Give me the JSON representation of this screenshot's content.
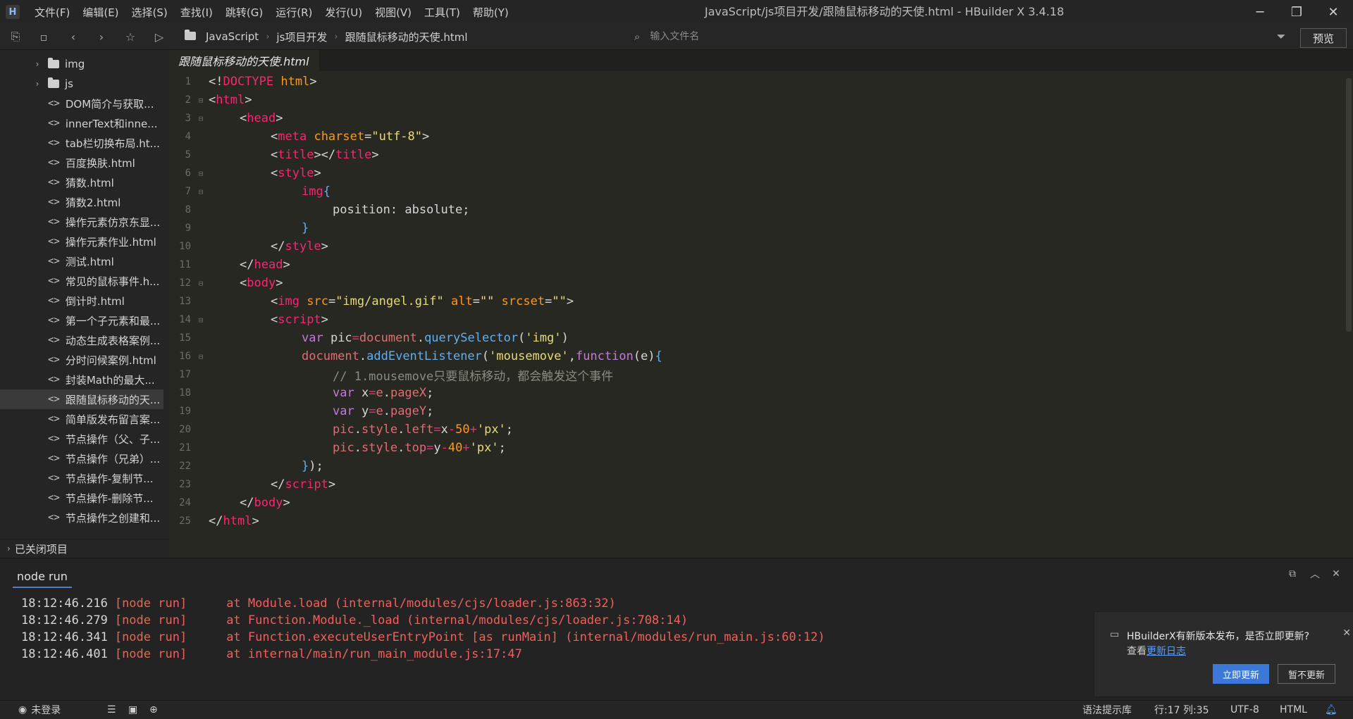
{
  "window": {
    "title": "JavaScript/js项目开发/跟随鼠标移动的天使.html - HBuilder X 3.4.18",
    "logo": "H",
    "controls": [
      "minimize-icon",
      "restore-icon",
      "close-icon"
    ]
  },
  "menu": [
    "文件(F)",
    "编辑(E)",
    "选择(S)",
    "查找(I)",
    "跳转(G)",
    "运行(R)",
    "发行(U)",
    "视图(V)",
    "工具(T)",
    "帮助(Y)"
  ],
  "toolbar": {
    "breadcrumb": [
      "JavaScript",
      "js项目开发",
      "跟随鼠标移动的天使.html"
    ],
    "file_search_placeholder": "输入文件名",
    "preview_label": "预览"
  },
  "sidebar": {
    "items": [
      {
        "label": "img",
        "type": "folder"
      },
      {
        "label": "js",
        "type": "folder"
      },
      {
        "label": "DOM简介与获取...",
        "type": "file"
      },
      {
        "label": "innerText和inne...",
        "type": "file"
      },
      {
        "label": "tab栏切换布局.ht...",
        "type": "file"
      },
      {
        "label": "百度换肤.html",
        "type": "file"
      },
      {
        "label": "猜数.html",
        "type": "file"
      },
      {
        "label": "猜数2.html",
        "type": "file"
      },
      {
        "label": "操作元素仿京东显...",
        "type": "file"
      },
      {
        "label": "操作元素作业.html",
        "type": "file"
      },
      {
        "label": "测试.html",
        "type": "file"
      },
      {
        "label": "常见的鼠标事件.h...",
        "type": "file"
      },
      {
        "label": "倒计时.html",
        "type": "file"
      },
      {
        "label": "第一个子元素和最...",
        "type": "file"
      },
      {
        "label": "动态生成表格案例...",
        "type": "file"
      },
      {
        "label": "分时问候案例.html",
        "type": "file"
      },
      {
        "label": "封装Math的最大...",
        "type": "file"
      },
      {
        "label": "跟随鼠标移动的天...",
        "type": "file",
        "selected": true
      },
      {
        "label": "简单版发布留言案...",
        "type": "file"
      },
      {
        "label": "节点操作（父、子...",
        "type": "file"
      },
      {
        "label": "节点操作（兄弟）...",
        "type": "file"
      },
      {
        "label": "节点操作-复制节...",
        "type": "file"
      },
      {
        "label": "节点操作-删除节...",
        "type": "file"
      },
      {
        "label": "节点操作之创建和...",
        "type": "file"
      }
    ],
    "closed_projects": "已关闭项目"
  },
  "editor": {
    "tab": "跟随鼠标移动的天使.html",
    "lines": [
      {
        "n": "1",
        "fold": "",
        "indent": 0,
        "tokens": [
          [
            "c-br",
            "<!"
          ],
          [
            "c-tag",
            "DOCTYPE"
          ],
          [
            "c-pl",
            " "
          ],
          [
            "c-attr",
            "html"
          ],
          [
            "c-br",
            ">"
          ]
        ]
      },
      {
        "n": "2",
        "fold": "⊟",
        "indent": 0,
        "tokens": [
          [
            "c-br",
            "<"
          ],
          [
            "c-tag",
            "html"
          ],
          [
            "c-br",
            ">"
          ]
        ]
      },
      {
        "n": "3",
        "fold": "⊟",
        "indent": 1,
        "tokens": [
          [
            "c-br",
            "<"
          ],
          [
            "c-tag",
            "head"
          ],
          [
            "c-br",
            ">"
          ]
        ]
      },
      {
        "n": "4",
        "fold": "",
        "indent": 2,
        "tokens": [
          [
            "c-br",
            "<"
          ],
          [
            "c-tag",
            "meta"
          ],
          [
            "c-pl",
            " "
          ],
          [
            "c-attr",
            "charset"
          ],
          [
            "c-br",
            "="
          ],
          [
            "c-str",
            "\"utf-8\""
          ],
          [
            "c-br",
            ">"
          ]
        ]
      },
      {
        "n": "5",
        "fold": "",
        "indent": 2,
        "tokens": [
          [
            "c-br",
            "<"
          ],
          [
            "c-tag",
            "title"
          ],
          [
            "c-br",
            "></"
          ],
          [
            "c-tag",
            "title"
          ],
          [
            "c-br",
            ">"
          ]
        ]
      },
      {
        "n": "6",
        "fold": "⊟",
        "indent": 2,
        "tokens": [
          [
            "c-br",
            "<"
          ],
          [
            "c-tag",
            "style"
          ],
          [
            "c-br",
            ">"
          ]
        ]
      },
      {
        "n": "7",
        "fold": "⊟",
        "indent": 3,
        "tokens": [
          [
            "c-tag",
            "img"
          ],
          [
            "c-fn",
            "{"
          ]
        ]
      },
      {
        "n": "8",
        "fold": "",
        "indent": 4,
        "tokens": [
          [
            "c-pl",
            "position"
          ],
          [
            "c-br",
            ": "
          ],
          [
            "c-pl",
            "absolute"
          ],
          [
            "c-br",
            ";"
          ]
        ]
      },
      {
        "n": "9",
        "fold": "",
        "indent": 3,
        "tokens": [
          [
            "c-fn",
            "}"
          ]
        ]
      },
      {
        "n": "10",
        "fold": "",
        "indent": 2,
        "tokens": [
          [
            "c-br",
            "</"
          ],
          [
            "c-tag",
            "style"
          ],
          [
            "c-br",
            ">"
          ]
        ]
      },
      {
        "n": "11",
        "fold": "",
        "indent": 1,
        "tokens": [
          [
            "c-br",
            "</"
          ],
          [
            "c-tag",
            "head"
          ],
          [
            "c-br",
            ">"
          ]
        ]
      },
      {
        "n": "12",
        "fold": "⊟",
        "indent": 1,
        "tokens": [
          [
            "c-br",
            "<"
          ],
          [
            "c-tag",
            "body"
          ],
          [
            "c-br",
            ">"
          ]
        ]
      },
      {
        "n": "13",
        "fold": "",
        "indent": 2,
        "tokens": [
          [
            "c-br",
            "<"
          ],
          [
            "c-tag",
            "img"
          ],
          [
            "c-pl",
            " "
          ],
          [
            "c-attr",
            "src"
          ],
          [
            "c-br",
            "="
          ],
          [
            "c-str",
            "\"img/angel.gif\""
          ],
          [
            "c-pl",
            " "
          ],
          [
            "c-attr",
            "alt"
          ],
          [
            "c-br",
            "="
          ],
          [
            "c-str",
            "\"\""
          ],
          [
            "c-pl",
            " "
          ],
          [
            "c-attr",
            "srcset"
          ],
          [
            "c-br",
            "="
          ],
          [
            "c-str",
            "\"\""
          ],
          [
            "c-br",
            ">"
          ]
        ]
      },
      {
        "n": "14",
        "fold": "⊟",
        "indent": 2,
        "tokens": [
          [
            "c-br",
            "<"
          ],
          [
            "c-tag",
            "script"
          ],
          [
            "c-br",
            ">"
          ]
        ]
      },
      {
        "n": "15",
        "fold": "",
        "indent": 3,
        "tokens": [
          [
            "c-kw",
            "var"
          ],
          [
            "c-pl",
            " pic"
          ],
          [
            "c-tag",
            "="
          ],
          [
            "c-var",
            "document"
          ],
          [
            "c-br",
            "."
          ],
          [
            "c-fn",
            "querySelector"
          ],
          [
            "c-br",
            "("
          ],
          [
            "c-str",
            "'img'"
          ],
          [
            "c-br",
            ")"
          ]
        ]
      },
      {
        "n": "16",
        "fold": "⊟",
        "indent": 3,
        "tokens": [
          [
            "c-var",
            "document"
          ],
          [
            "c-br",
            "."
          ],
          [
            "c-fn",
            "addEventListener"
          ],
          [
            "c-br",
            "("
          ],
          [
            "c-str",
            "'mousemove'"
          ],
          [
            "c-br",
            ","
          ],
          [
            "c-kw",
            "function"
          ],
          [
            "c-br",
            "("
          ],
          [
            "c-pl",
            "e"
          ],
          [
            "c-br",
            ")"
          ],
          [
            "c-fn",
            "{"
          ]
        ]
      },
      {
        "n": "17",
        "fold": "",
        "indent": 4,
        "tokens": [
          [
            "c-cm",
            "// 1.mousemove只要鼠标移动，都会触发这个事件"
          ]
        ]
      },
      {
        "n": "18",
        "fold": "",
        "indent": 4,
        "tokens": [
          [
            "c-kw",
            "var"
          ],
          [
            "c-pl",
            " x"
          ],
          [
            "c-tag",
            "="
          ],
          [
            "c-var",
            "e"
          ],
          [
            "c-br",
            "."
          ],
          [
            "c-var",
            "pageX"
          ],
          [
            "c-br",
            ";"
          ]
        ]
      },
      {
        "n": "19",
        "fold": "",
        "indent": 4,
        "tokens": [
          [
            "c-kw",
            "var"
          ],
          [
            "c-pl",
            " y"
          ],
          [
            "c-tag",
            "="
          ],
          [
            "c-var",
            "e"
          ],
          [
            "c-br",
            "."
          ],
          [
            "c-var",
            "pageY"
          ],
          [
            "c-br",
            ";"
          ]
        ]
      },
      {
        "n": "20",
        "fold": "",
        "indent": 4,
        "tokens": [
          [
            "c-var",
            "pic"
          ],
          [
            "c-br",
            "."
          ],
          [
            "c-var",
            "style"
          ],
          [
            "c-br",
            "."
          ],
          [
            "c-var",
            "left"
          ],
          [
            "c-tag",
            "="
          ],
          [
            "c-pl",
            "x"
          ],
          [
            "c-tag",
            "-"
          ],
          [
            "c-attr",
            "50"
          ],
          [
            "c-tag",
            "+"
          ],
          [
            "c-str",
            "'px'"
          ],
          [
            "c-br",
            ";"
          ]
        ]
      },
      {
        "n": "21",
        "fold": "",
        "indent": 4,
        "tokens": [
          [
            "c-var",
            "pic"
          ],
          [
            "c-br",
            "."
          ],
          [
            "c-var",
            "style"
          ],
          [
            "c-br",
            "."
          ],
          [
            "c-var",
            "top"
          ],
          [
            "c-tag",
            "="
          ],
          [
            "c-pl",
            "y"
          ],
          [
            "c-tag",
            "-"
          ],
          [
            "c-attr",
            "40"
          ],
          [
            "c-tag",
            "+"
          ],
          [
            "c-str",
            "'px'"
          ],
          [
            "c-br",
            ";"
          ]
        ]
      },
      {
        "n": "22",
        "fold": "",
        "indent": 3,
        "tokens": [
          [
            "c-fn",
            "}"
          ],
          [
            "c-br",
            ");"
          ]
        ]
      },
      {
        "n": "23",
        "fold": "",
        "indent": 2,
        "tokens": [
          [
            "c-br",
            "</"
          ],
          [
            "c-tag",
            "script"
          ],
          [
            "c-br",
            ">"
          ]
        ]
      },
      {
        "n": "24",
        "fold": "",
        "indent": 1,
        "tokens": [
          [
            "c-br",
            "</"
          ],
          [
            "c-tag",
            "body"
          ],
          [
            "c-br",
            ">"
          ]
        ]
      },
      {
        "n": "25",
        "fold": "",
        "indent": 0,
        "tokens": [
          [
            "c-br",
            "</"
          ],
          [
            "c-tag",
            "html"
          ],
          [
            "c-br",
            ">"
          ]
        ]
      }
    ]
  },
  "console": {
    "tab": "node run",
    "logs": [
      {
        "time": "18:12:46.216",
        "src": "[node run]",
        "msg": "at Module.load (internal/modules/cjs/loader.js:863:32)"
      },
      {
        "time": "18:12:46.279",
        "src": "[node run]",
        "msg": "at Function.Module._load (internal/modules/cjs/loader.js:708:14)"
      },
      {
        "time": "18:12:46.341",
        "src": "[node run]",
        "msg": "at Function.executeUserEntryPoint [as runMain] (internal/modules/run_main.js:60:12)"
      },
      {
        "time": "18:12:46.401",
        "src": "[node run]",
        "msg": "at internal/main/run_main_module.js:17:47"
      }
    ]
  },
  "notification": {
    "message": "HBuilderX有新版本发布，是否立即更新?",
    "link_prefix": "查看",
    "link_text": "更新日志",
    "update_label": "立即更新",
    "later_label": "暂不更新"
  },
  "statusbar": {
    "user": "未登录",
    "syntax_lib": "语法提示库",
    "position": "行:17  列:35",
    "encoding": "UTF-8",
    "language": "HTML"
  },
  "colors": {
    "accent": "#3c78d8",
    "error": "#f0605a",
    "editor_bg": "#272822"
  }
}
